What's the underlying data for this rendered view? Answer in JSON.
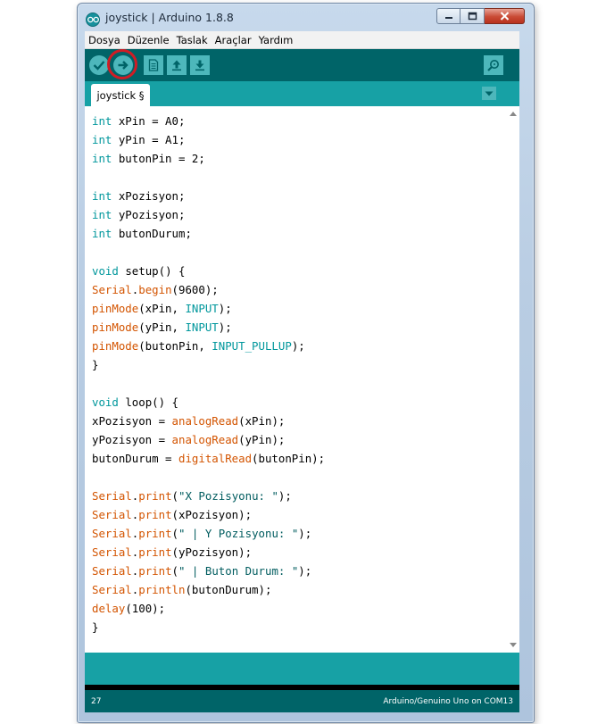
{
  "window": {
    "title": "joystick | Arduino 1.8.8"
  },
  "menu": [
    "Dosya",
    "Düzenle",
    "Taslak",
    "Araçlar",
    "Yardım"
  ],
  "toolbar": {
    "buttons": [
      "verify-icon",
      "upload-icon",
      "new-sketch-icon",
      "open-icon",
      "save-icon",
      "serial-monitor-icon"
    ],
    "highlighted_button": "upload-icon"
  },
  "tab": {
    "label": "joystick §"
  },
  "colors": {
    "toolbar": "#006468",
    "tabstrip": "#17a1a5",
    "keyword": "#00979c",
    "function": "#d35400",
    "highlight_ring": "#d11d25"
  },
  "code": [
    [
      [
        "kw",
        "int"
      ],
      [
        "",
        "xPin = A0;"
      ]
    ],
    [
      [
        "kw",
        "int"
      ],
      [
        "",
        "yPin = A1;"
      ]
    ],
    [
      [
        "kw",
        "int"
      ],
      [
        "",
        "butonPin = 2;"
      ]
    ],
    [],
    [
      [
        "kw",
        "int"
      ],
      [
        "",
        "xPozisyon;"
      ]
    ],
    [
      [
        "kw",
        "int"
      ],
      [
        "",
        "yPozisyon;"
      ]
    ],
    [
      [
        "kw",
        "int"
      ],
      [
        "",
        "butonDurum;"
      ]
    ],
    [],
    [
      [
        "kw",
        "void"
      ],
      [
        "",
        "setup() {"
      ]
    ],
    [
      [
        "fn",
        "Serial"
      ],
      [
        "",
        "."
      ],
      [
        "fn",
        "begin"
      ],
      [
        "",
        "(9600);"
      ]
    ],
    [
      [
        "fn",
        "pinMode"
      ],
      [
        "",
        "(xPin, "
      ],
      [
        "cst",
        "INPUT"
      ],
      [
        "",
        ");"
      ]
    ],
    [
      [
        "fn",
        "pinMode"
      ],
      [
        "",
        "(yPin, "
      ],
      [
        "cst",
        "INPUT"
      ],
      [
        "",
        ");"
      ]
    ],
    [
      [
        "fn",
        "pinMode"
      ],
      [
        "",
        "(butonPin, "
      ],
      [
        "cst",
        "INPUT_PULLUP"
      ],
      [
        "",
        ");"
      ]
    ],
    [
      [
        "",
        "}"
      ]
    ],
    [],
    [
      [
        "kw",
        "void"
      ],
      [
        "",
        "loop() {"
      ]
    ],
    [
      [
        "",
        "xPozisyon = "
      ],
      [
        "fn",
        "analogRead"
      ],
      [
        "",
        "(xPin);"
      ]
    ],
    [
      [
        "",
        "yPozisyon = "
      ],
      [
        "fn",
        "analogRead"
      ],
      [
        "",
        "(yPin);"
      ]
    ],
    [
      [
        "",
        "butonDurum = "
      ],
      [
        "fn",
        "digitalRead"
      ],
      [
        "",
        "(butonPin);"
      ]
    ],
    [],
    [
      [
        "fn",
        "Serial"
      ],
      [
        "",
        "."
      ],
      [
        "fn",
        "print"
      ],
      [
        "",
        "("
      ],
      [
        "str",
        "\"X Pozisyonu: \""
      ],
      [
        "",
        ");"
      ]
    ],
    [
      [
        "fn",
        "Serial"
      ],
      [
        "",
        "."
      ],
      [
        "fn",
        "print"
      ],
      [
        "",
        "(xPozisyon);"
      ]
    ],
    [
      [
        "fn",
        "Serial"
      ],
      [
        "",
        "."
      ],
      [
        "fn",
        "print"
      ],
      [
        "",
        "("
      ],
      [
        "str",
        "\" | Y Pozisyonu: \""
      ],
      [
        "",
        ");"
      ]
    ],
    [
      [
        "fn",
        "Serial"
      ],
      [
        "",
        "."
      ],
      [
        "fn",
        "print"
      ],
      [
        "",
        "(yPozisyon);"
      ]
    ],
    [
      [
        "fn",
        "Serial"
      ],
      [
        "",
        "."
      ],
      [
        "fn",
        "print"
      ],
      [
        "",
        "("
      ],
      [
        "str",
        "\" | Buton Durum: \""
      ],
      [
        "",
        ");"
      ]
    ],
    [
      [
        "fn",
        "Serial"
      ],
      [
        "",
        "."
      ],
      [
        "fn",
        "println"
      ],
      [
        "",
        "(butonDurum);"
      ]
    ],
    [
      [
        "fn",
        "delay"
      ],
      [
        "",
        "(100);"
      ]
    ],
    [
      [
        "",
        "}"
      ]
    ]
  ],
  "status": {
    "line_number": "27",
    "board": "Arduino/Genuino Uno on COM13"
  }
}
